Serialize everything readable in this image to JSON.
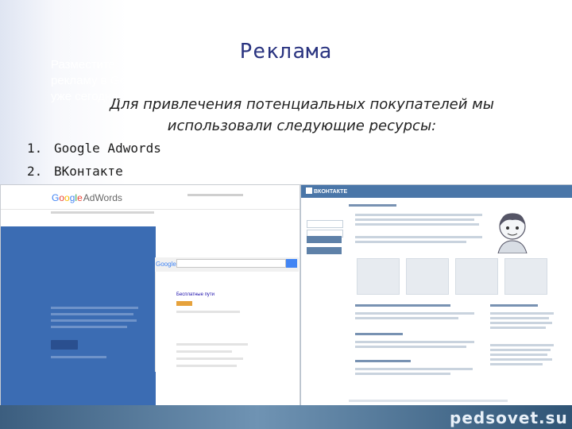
{
  "slide": {
    "title": "Реклама",
    "intro": "Для привлечения потенциальных покупателей мы использовали следующие ресурсы:",
    "items": [
      {
        "num": "1.",
        "text": "Google Adwords"
      },
      {
        "num": "2.",
        "text": "ВКонтакте"
      }
    ],
    "brand": "pedsovet.su"
  },
  "adwords": {
    "logo_parts": [
      "G",
      "o",
      "o",
      "g",
      "l",
      "e"
    ],
    "logo_suffix": "AdWords",
    "hero_heading": "Разместите рекламу в Google уже сегодня!",
    "search_logo": "Google",
    "result_title": "Бесплатные пути"
  },
  "vk": {
    "logo": "ВКОНТАКТЕ"
  },
  "colors": {
    "title": "#2a3480",
    "adwords_hero": "#3b6cb3",
    "vk_header": "#4a76a8"
  }
}
